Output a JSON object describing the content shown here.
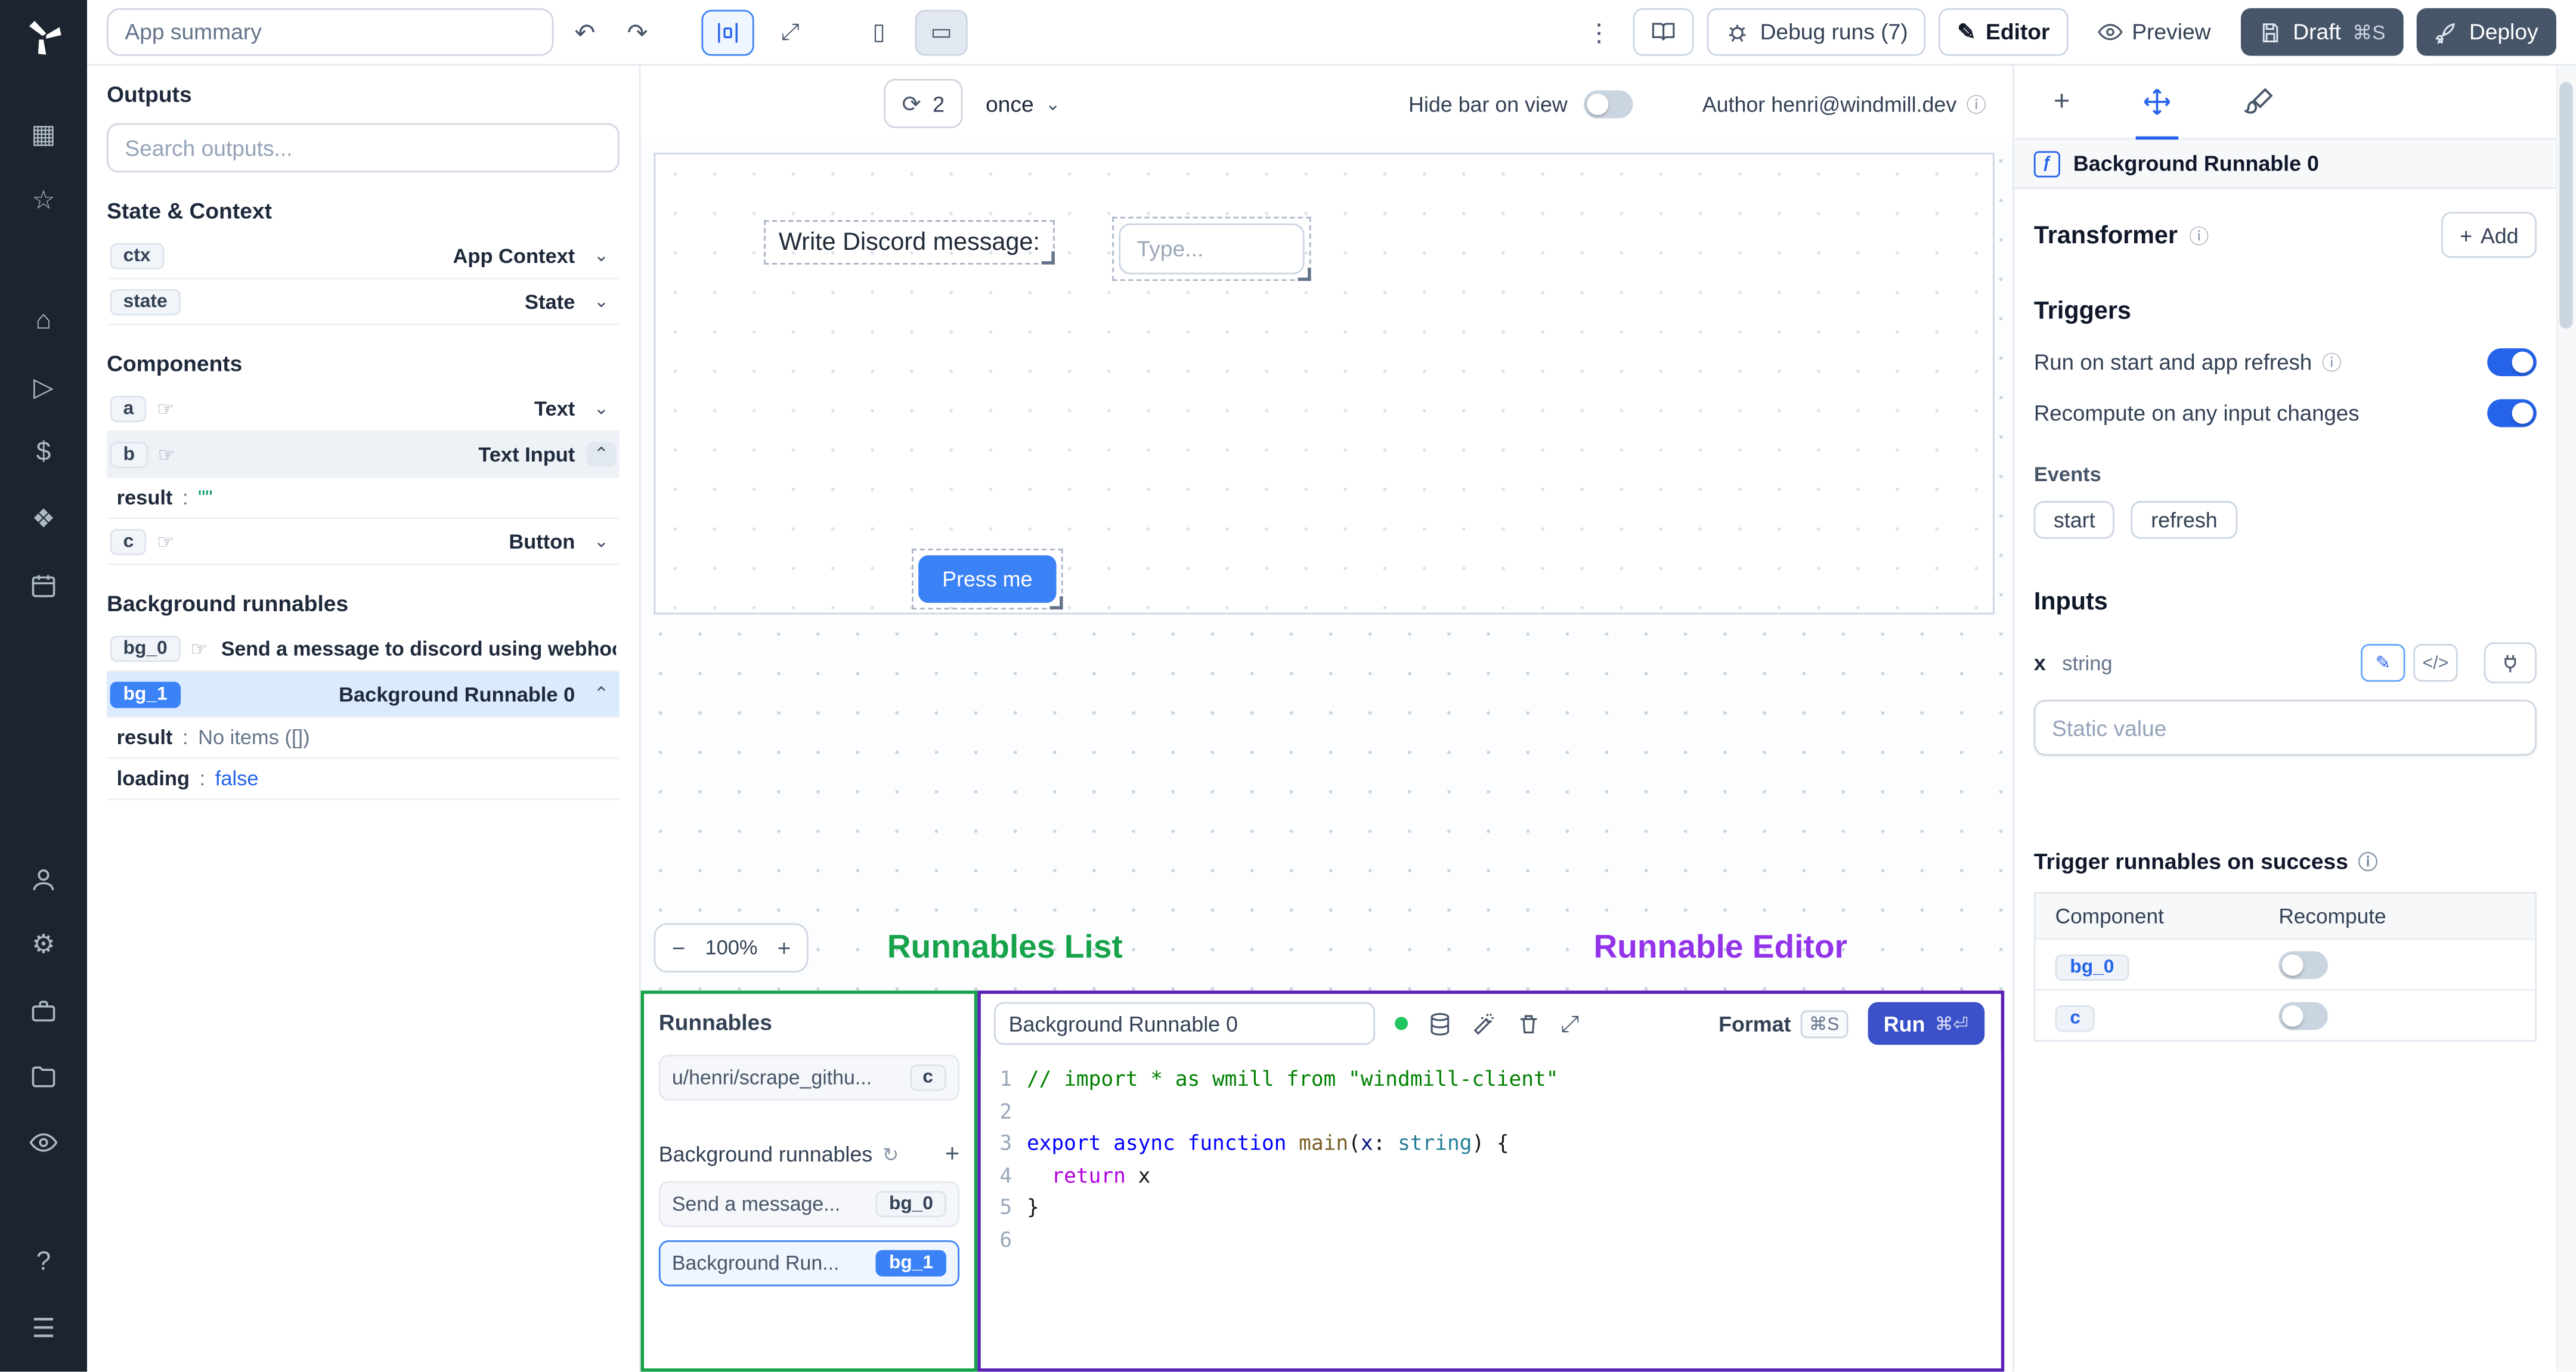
{
  "misc": {
    "colon": ":"
  },
  "icons": {
    "undo": "↶",
    "redo": "↷",
    "kebab": "⋮",
    "chevron_down": "⌄",
    "chevron_up": "⌃",
    "refresh": "⟳",
    "info": "ⓘ",
    "hand": "☞",
    "plus": "+",
    "minus": "−",
    "expand": "⤢",
    "pen": "✎",
    "gear": "⚙",
    "help": "?",
    "menu": "☰",
    "star": "☆",
    "home": "⌂",
    "play": "▷",
    "dollar": "$",
    "grid": "▦",
    "apps": "❖",
    "phone": "▯",
    "desktop": "▭",
    "wand": "✦",
    "code": "</>",
    "fn": "ƒ",
    "recompute": "↻"
  },
  "topbar": {
    "app_summary": "App summary",
    "debug_runs": "Debug runs (7)",
    "editor": "Editor",
    "preview": "Preview",
    "draft": "Draft",
    "draft_kbd": "⌘S",
    "deploy": "Deploy"
  },
  "outputs": {
    "title": "Outputs",
    "search_placeholder": "Search outputs...",
    "state_context_title": "State & Context",
    "ctx_badge": "ctx",
    "ctx_label": "App Context",
    "state_badge": "state",
    "state_label": "State",
    "components_title": "Components",
    "a_badge": "a",
    "a_label": "Text",
    "b_badge": "b",
    "b_label": "Text Input",
    "b_result_key": "result",
    "b_result_value": "\"\"",
    "c_badge": "c",
    "c_label": "Button",
    "background_title": "Background runnables",
    "bg0_badge": "bg_0",
    "bg0_label": "Send a message to discord using webhoo",
    "bg1_badge": "bg_1",
    "bg1_label": "Background Runnable 0",
    "bg1_result_key": "result",
    "bg1_result_value": "No items ([])",
    "bg1_loading_key": "loading",
    "bg1_loading_value": "false"
  },
  "canvas": {
    "refresh_count": "2",
    "frequency": "once",
    "hide_bar_label": "Hide bar on view",
    "author": "Author henri@windmill.dev",
    "component_text": "Write Discord message:",
    "input_placeholder": "Type...",
    "button_label": "Press me",
    "zoom_level": "100%"
  },
  "annotations": {
    "runnables_list": "Runnables List",
    "runnable_editor": "Runnable Editor"
  },
  "runnables": {
    "title": "Runnables",
    "script_label": "u/henri/scrape_githu...",
    "script_badge": "c",
    "background_title": "Background runnables",
    "item0_label": "Send a message...",
    "item0_badge": "bg_0",
    "item1_label": "Background Run...",
    "item1_badge": "bg_1"
  },
  "editor": {
    "name": "Background Runnable 0",
    "format": "Format",
    "format_kbd": "⌘S",
    "run": "Run",
    "run_kbd": "⌘⏎",
    "lines": [
      "1",
      "2",
      "3",
      "4",
      "5",
      "6"
    ],
    "code": {
      "l1": "// import * as wmill from \"windmill-client\"",
      "l3": [
        "export ",
        "async ",
        "function ",
        "main",
        "(",
        "x",
        ": ",
        "string",
        ") {"
      ],
      "l4": [
        "  ",
        "return",
        " x"
      ],
      "l5": "}"
    }
  },
  "panel": {
    "header": "Background Runnable 0",
    "transformer_title": "Transformer",
    "add_label": "Add",
    "triggers_title": "Triggers",
    "trigger1": "Run on start and app refresh",
    "trigger2": "Recompute on any input changes",
    "events_label": "Events",
    "event_chips": [
      "start",
      "refresh"
    ],
    "inputs_title": "Inputs",
    "input_name": "x",
    "input_type": "string",
    "static_placeholder": "Static value",
    "success_title": "Trigger runnables on success",
    "table": {
      "col1": "Component",
      "col2": "Recompute",
      "rows": [
        {
          "badge": "bg_0"
        },
        {
          "badge": "c"
        }
      ]
    }
  }
}
